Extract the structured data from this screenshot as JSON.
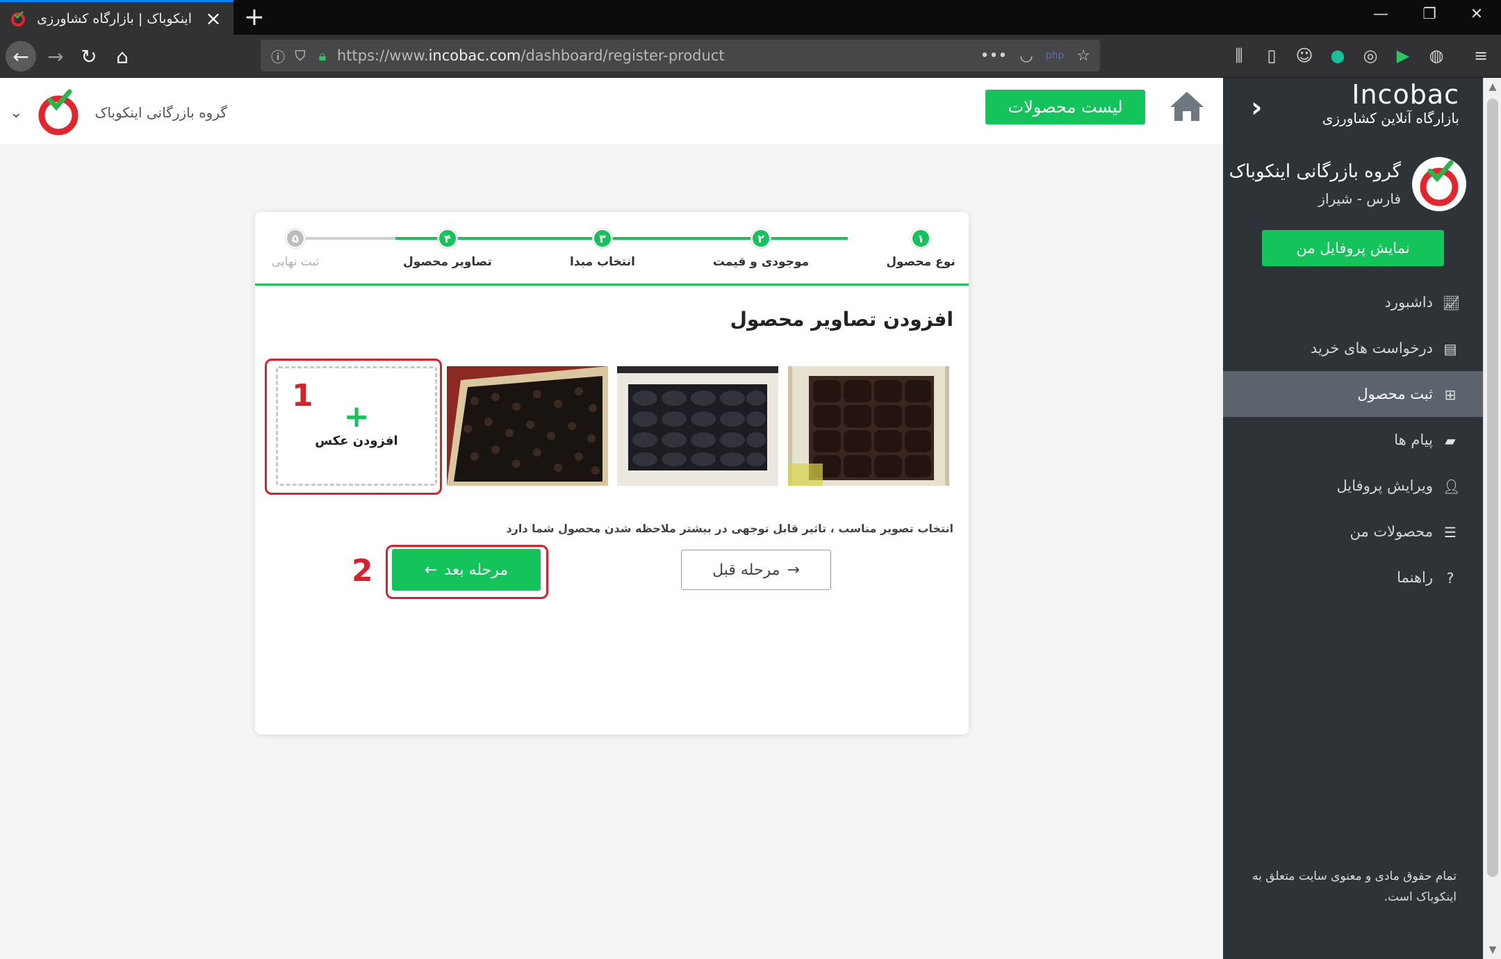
{
  "browser": {
    "tab_title": "اینکوباک | بازارگاه کشاورزی",
    "url_prefix": "https://www.",
    "url_domain": "incobac.com",
    "url_path": "/dashboard/register-product"
  },
  "header": {
    "company_name": "گروه بازرگانی اینکوباک",
    "products_button": "لیست محصولات"
  },
  "sidebar": {
    "brand": "Incobac",
    "tagline": "بازارگاه آنلاین کشاورزی",
    "profile_name": "گروه بازرگانی اینکوباک",
    "profile_location": "فارس - شیراز",
    "profile_button": "نمایش پروفایل من",
    "menu": [
      {
        "label": "داشبورد",
        "icon": "chart-icon"
      },
      {
        "label": "درخواست های خرید",
        "icon": "list-icon"
      },
      {
        "label": "ثبت محصول",
        "icon": "plus-square-icon",
        "active": true
      },
      {
        "label": "پیام ها",
        "icon": "chat-icon"
      },
      {
        "label": "ویرایش پروفایل",
        "icon": "user-icon"
      },
      {
        "label": "محصولات من",
        "icon": "list-ol-icon"
      },
      {
        "label": "راهنما",
        "icon": "question-icon"
      }
    ],
    "footer": "تمام حقوق مادی و معنوی سایت متعلق به اینکوباک است."
  },
  "stepper": {
    "steps": [
      {
        "num": "۱",
        "label": "نوع محصول",
        "state": "done"
      },
      {
        "num": "۲",
        "label": "موجودی و قیمت",
        "state": "done"
      },
      {
        "num": "۳",
        "label": "انتخاب مبدا",
        "state": "done"
      },
      {
        "num": "۴",
        "label": "تصاویر محصول",
        "state": "current"
      },
      {
        "num": "۵",
        "label": "ثبت نهایی",
        "state": "pending"
      }
    ]
  },
  "content": {
    "title": "افزودن تصاویر محصول",
    "add_photo_label": "افزودن عکس",
    "hint": "انتخاب تصویر مناسب ، تاثیر قابل توجهی در بیشتر ملاحظه شدن محصول شما دارد",
    "prev_button": "مرحله قبل",
    "next_button": "مرحله بعد"
  },
  "annotations": {
    "one": "1",
    "two": "2"
  },
  "colors": {
    "accent": "#14c35a",
    "highlight": "#d7222c",
    "sidebar_bg": "#2e3338"
  }
}
